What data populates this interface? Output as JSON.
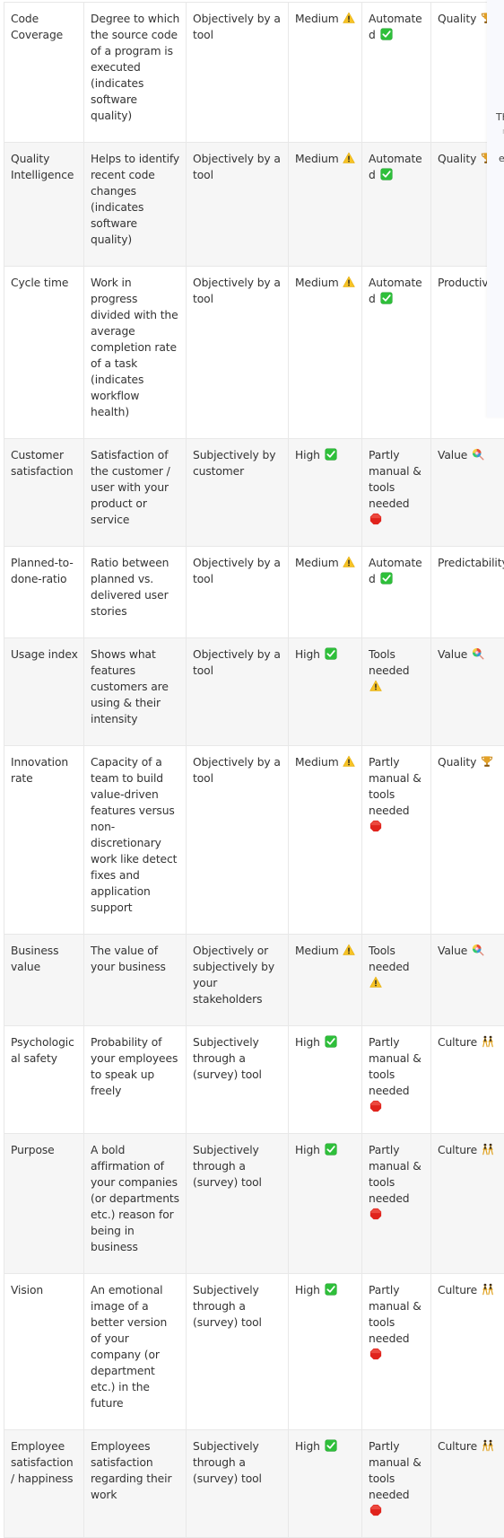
{
  "table": {
    "rows": [
      {
        "name": "Code Coverage",
        "description": "Degree to which the source code of a program is executed (indicates software quality)",
        "measurement": "Objectively by a tool",
        "effort": "Medium",
        "effort_icon": "warning-icon",
        "automation": "Automated",
        "automation_icon": "check-box-icon",
        "category": "Quality",
        "category_icon": "trophy-icon"
      },
      {
        "name": "Quality Intelligence",
        "description": "Helps to identify recent code changes (indicates software quality)",
        "measurement": "Objectively by a tool",
        "effort": "Medium",
        "effort_icon": "warning-icon",
        "automation": "Automated",
        "automation_icon": "check-box-icon",
        "category": "Quality",
        "category_icon": "trophy-icon"
      },
      {
        "name": "Cycle time",
        "description": "Work in progress divided with the average completion rate of a task (indicates workflow health)",
        "measurement": "Objectively by a tool",
        "effort": "Medium",
        "effort_icon": "warning-icon",
        "automation": "Automated",
        "automation_icon": "check-box-icon",
        "category": "Productivity",
        "category_icon": "runner-icon"
      },
      {
        "name": "Customer satisfaction",
        "description": "Satisfaction of the customer / user with your product or service",
        "measurement": "Subjectively by customer",
        "effort": "High",
        "effort_icon": "check-box-icon",
        "automation": "Partly manual & tools needed",
        "automation_icon": "stop-sign-icon",
        "category": "Value",
        "category_icon": "lollipop-icon"
      },
      {
        "name": "Planned-to-done-ratio",
        "description": "Ratio between planned vs. delivered user stories",
        "measurement": "Objectively by a tool",
        "effort": "Medium",
        "effort_icon": "warning-icon",
        "automation": "Automated",
        "automation_icon": "check-box-icon",
        "category": "Predictability",
        "category_icon": "dice-icon"
      },
      {
        "name": "Usage index",
        "description": "Shows what features customers are using & their intensity",
        "measurement": "Objectively by a tool",
        "effort": "High",
        "effort_icon": "check-box-icon",
        "automation": "Tools needed",
        "automation_icon": "warning-icon",
        "category": "Value",
        "category_icon": "lollipop-icon"
      },
      {
        "name": "Innovation rate",
        "description": "Capacity of a team to build value-driven features versus non-discretionary work like detect fixes and application support",
        "measurement": "Objectively by a tool",
        "effort": "Medium",
        "effort_icon": "warning-icon",
        "automation": "Partly manual & tools needed",
        "automation_icon": "stop-sign-icon",
        "category": "Quality",
        "category_icon": "trophy-icon"
      },
      {
        "name": "Business value",
        "description": "The value of your business",
        "measurement": "Objectively or subjectively by your stakeholders",
        "effort": "Medium",
        "effort_icon": "warning-icon",
        "automation": "Tools needed",
        "automation_icon": "warning-icon",
        "category": "Value",
        "category_icon": "lollipop-icon"
      },
      {
        "name": "Psychological safety",
        "description": "Probability of your employees to speak up freely",
        "measurement": "Subjectively through a (survey) tool",
        "effort": "High",
        "effort_icon": "check-box-icon",
        "automation": "Partly manual & tools needed",
        "automation_icon": "stop-sign-icon",
        "category": "Culture",
        "category_icon": "dancers-icon"
      },
      {
        "name": "Purpose",
        "description": "A bold affirmation of your companies (or departments etc.) reason for being in business",
        "measurement": "Subjectively through a (survey) tool",
        "effort": "High",
        "effort_icon": "check-box-icon",
        "automation": "Partly manual & tools needed",
        "automation_icon": "stop-sign-icon",
        "category": "Culture",
        "category_icon": "dancers-icon"
      },
      {
        "name": "Vision",
        "description": "An emotional image of a better version of your company (or department etc.) in the future",
        "measurement": "Subjectively through a (survey) tool",
        "effort": "High",
        "effort_icon": "check-box-icon",
        "automation": "Partly manual & tools needed",
        "automation_icon": "stop-sign-icon",
        "category": "Culture",
        "category_icon": "dancers-icon"
      },
      {
        "name": "Employee satisfaction / happiness",
        "description": "Employees satisfaction regarding their work",
        "measurement": "Subjectively through a (survey) tool",
        "effort": "High",
        "effort_icon": "check-box-icon",
        "automation": "Partly manual & tools needed",
        "automation_icon": "stop-sign-icon",
        "category": "Culture",
        "category_icon": "dancers-icon"
      }
    ]
  },
  "overlay": {
    "line1": "Th",
    "line2": "r",
    "line3": "e"
  },
  "colors": {
    "warning": "#f7c325",
    "check": "#2ebf3a",
    "stop": "#e0231c",
    "trophy": "#d9911a",
    "border": "#e8e8e8",
    "row_alt": "#f6f6f6",
    "overlay_bg": "#f8f9fd"
  }
}
